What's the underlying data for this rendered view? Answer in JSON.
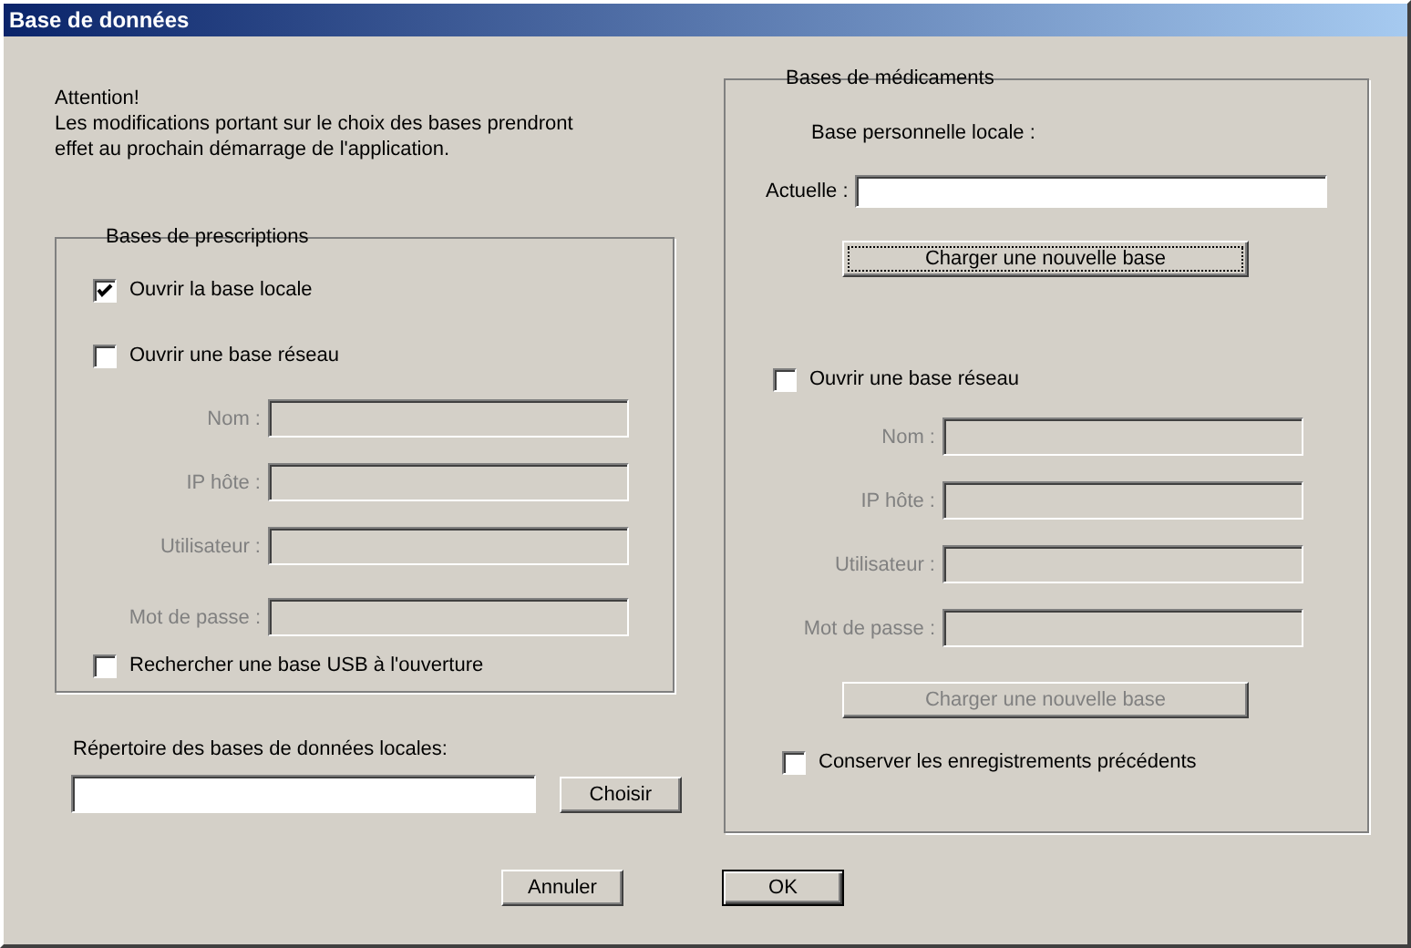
{
  "window": {
    "title": "Base de données"
  },
  "notice": {
    "heading": "Attention!",
    "text": "Les modifications portant sur le choix des bases prendront effet au prochain démarrage de l'application."
  },
  "prescriptions": {
    "title": "Bases de prescriptions",
    "local": {
      "label": "Ouvrir la base locale",
      "checked": true
    },
    "network": {
      "label": "Ouvrir une base réseau",
      "checked": false
    },
    "fields": [
      {
        "label": "Nom :",
        "disabled": true
      },
      {
        "label": "IP hôte :",
        "disabled": true
      },
      {
        "label": "Utilisateur :",
        "disabled": true
      },
      {
        "label": "Mot de passe :",
        "disabled": true
      }
    ],
    "usb": {
      "label": "Rechercher une base USB à l'ouverture",
      "checked": false
    }
  },
  "local_directory": {
    "label": "Répertoire des bases de données locales:",
    "button": "Choisir"
  },
  "medications": {
    "title": "Bases de médicaments",
    "personal_label": "Base personnelle locale :",
    "current": {
      "label": "Actuelle :"
    },
    "load_button": {
      "label": "Charger une nouvelle base",
      "disabled": false,
      "focused": true
    },
    "network": {
      "label": "Ouvrir une base réseau",
      "checked": false
    },
    "fields": [
      {
        "label": "Nom :",
        "disabled": true
      },
      {
        "label": "IP hôte :",
        "disabled": true
      },
      {
        "label": "Utilisateur :",
        "disabled": true
      },
      {
        "label": "Mot de passe :",
        "disabled": true
      }
    ],
    "network_load_button": {
      "label": "Charger une nouvelle base",
      "disabled": true,
      "focused": false
    },
    "keep": {
      "label": "Conserver les enregistrements précédents",
      "checked": false
    }
  },
  "buttons": [
    {
      "label": "Annuler",
      "default": false
    },
    {
      "label": "OK",
      "default": true
    }
  ]
}
